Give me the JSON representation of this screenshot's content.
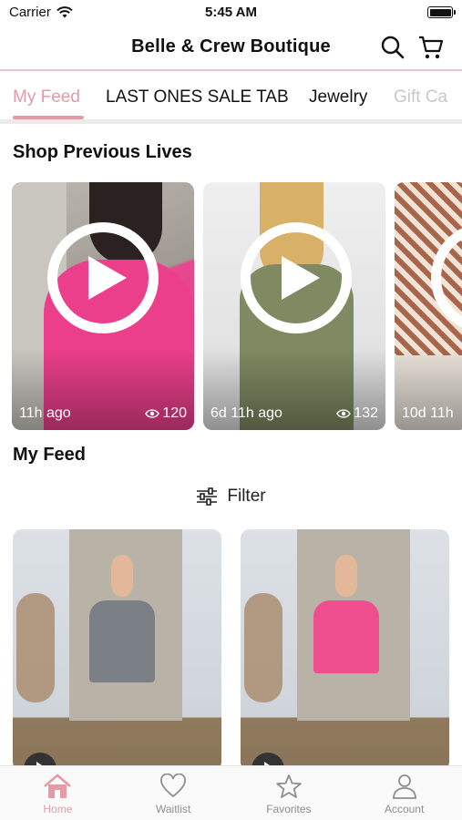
{
  "status_bar": {
    "carrier": "Carrier",
    "time": "5:45 AM"
  },
  "header": {
    "title": "Belle & Crew Boutique",
    "search_icon": "search-icon",
    "cart_icon": "cart-icon"
  },
  "tabs": [
    {
      "label": "My Feed",
      "active": true
    },
    {
      "label": "LAST ONES SALE TAB",
      "active": false
    },
    {
      "label": "Jewelry",
      "active": false
    },
    {
      "label": "Gift Ca",
      "active": false
    }
  ],
  "lives": {
    "title": "Shop Previous Lives",
    "items": [
      {
        "time": "11h ago",
        "views": "120"
      },
      {
        "time": "6d 11h ago",
        "views": "132"
      },
      {
        "time": "10d 11h",
        "views": ""
      }
    ]
  },
  "feed": {
    "title": "My Feed",
    "filter_label": "Filter"
  },
  "bottom_nav": [
    {
      "label": "Home",
      "icon": "home-icon",
      "active": true
    },
    {
      "label": "Waitlist",
      "icon": "heart-icon",
      "active": false
    },
    {
      "label": "Favorites",
      "icon": "star-icon",
      "active": false
    },
    {
      "label": "Account",
      "icon": "person-icon",
      "active": false
    }
  ],
  "colors": {
    "accent": "#e59aa7",
    "divider": "#e8c6cc",
    "inactive": "#8e8e8e"
  }
}
